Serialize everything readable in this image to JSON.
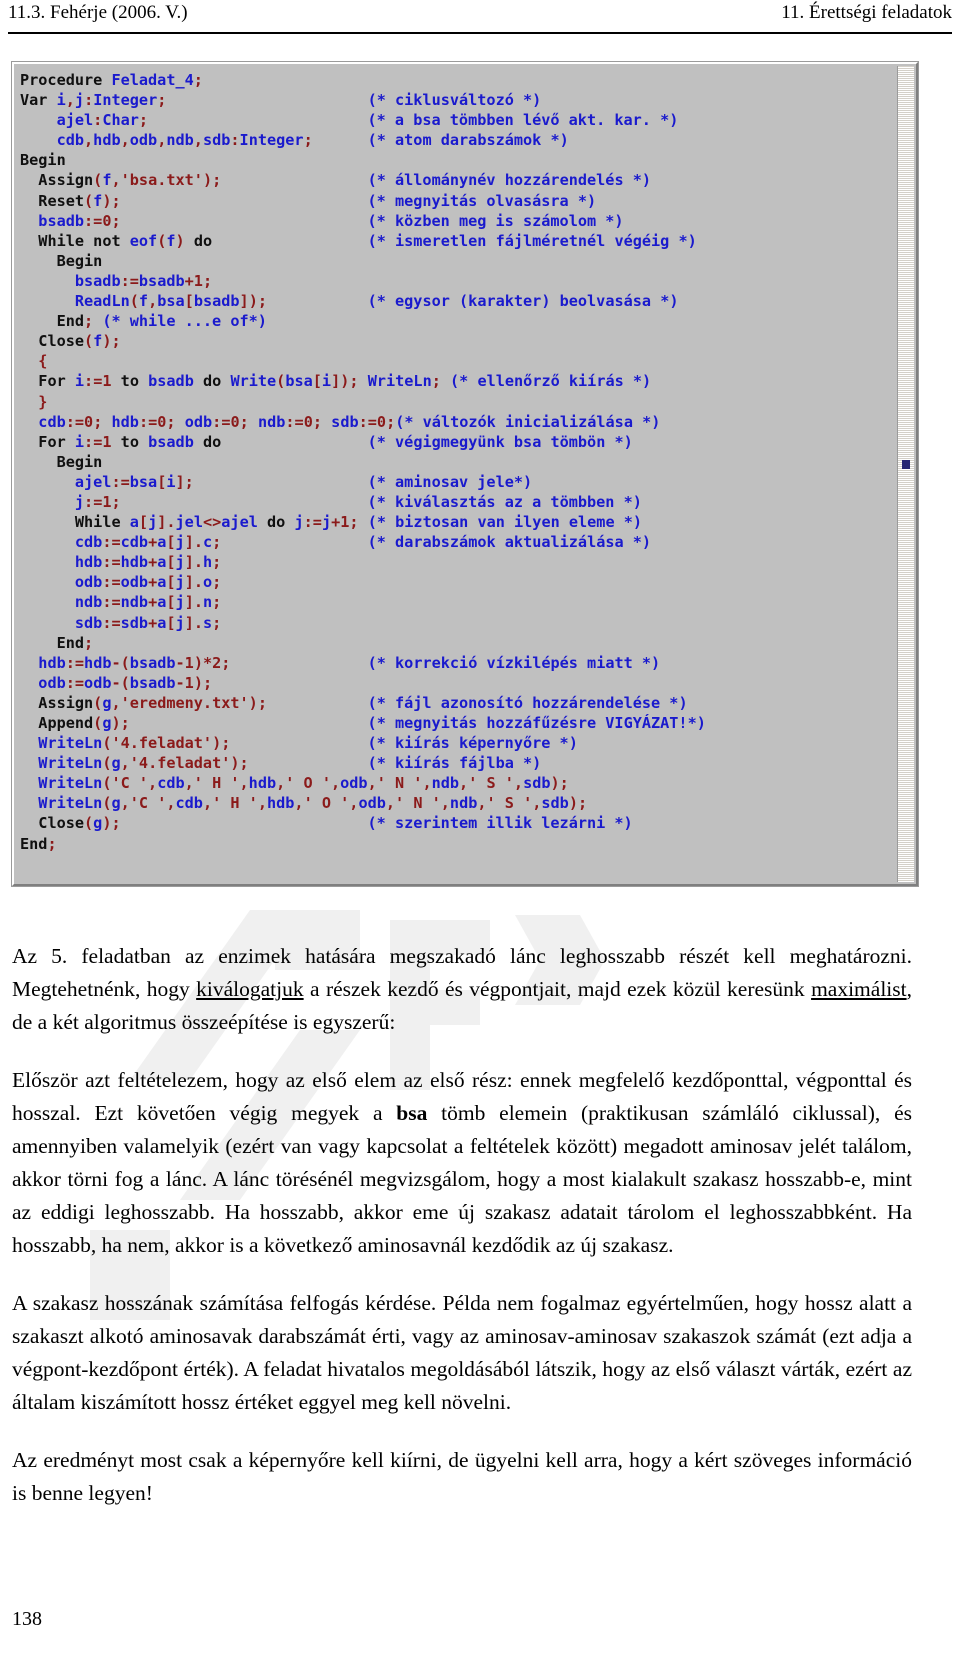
{
  "header": {
    "left": "11.3. Fehérje (2006. V.)",
    "right": "11. Érettségi feladatok"
  },
  "code_panel": {
    "language": "Pascal",
    "lines": [
      "Procedure Feladat_4;",
      "Var i,j:Integer;                      (* ciklusváltozó *)",
      "    ajel:Char;                        (* a bsa tömbben lévő akt. kar. *)",
      "    cdb,hdb,odb,ndb,sdb:Integer;      (* atom darabszámok *)",
      "Begin",
      "  Assign(f,'bsa.txt');                (* állománynév hozzárendelés *)",
      "  Reset(f);                           (* megnyitás olvasásra *)",
      "  bsadb:=0;                           (* közben meg is számolom *)",
      "  While not eof(f) do                 (* ismeretlen fájlméretnél végéig *)",
      "    Begin",
      "      bsadb:=bsadb+1;",
      "      ReadLn(f,bsa[bsadb]);           (* egysor (karakter) beolvasása *)",
      "    End; (* while ...e of*)",
      "  Close(f);",
      "  {",
      "  For i:=1 to bsadb do Write(bsa[i]); WriteLn; (* ellenőrző kiírás *)",
      "  }",
      "  cdb:=0; hdb:=0; odb:=0; ndb:=0; sdb:=0;(* változók inicializálása *)",
      "  For i:=1 to bsadb do                (* végigmegyünk bsa tömbön *)",
      "    Begin",
      "      ajel:=bsa[i];                   (* aminosav jele*)",
      "      j:=1;                           (* kiválasztás az a tömbben *)",
      "      While a[j].jel<>ajel do j:=j+1; (* biztosan van ilyen eleme *)",
      "      cdb:=cdb+a[j].c;                (* darabszámok aktualizálása *)",
      "      hdb:=hdb+a[j].h;",
      "      odb:=odb+a[j].o;",
      "      ndb:=ndb+a[j].n;",
      "      sdb:=sdb+a[j].s;",
      "    End;",
      "  hdb:=hdb-(bsadb-1)*2;               (* korrekció vízkilépés miatt *)",
      "  odb:=odb-(bsadb-1);",
      "  Assign(g,'eredmeny.txt');           (* fájl azonosító hozzárendelése *)",
      "  Append(g);                          (* megnyitás hozzáfűzésre VIGYÁZAT!*)",
      "  WriteLn('4.feladat');               (* kiírás képernyőre *)",
      "  WriteLn(g,'4.feladat');             (* kiírás fájlba *)",
      "  WriteLn('C ',cdb,' H ',hdb,' O ',odb,' N ',ndb,' S ',sdb);",
      "  WriteLn(g,'C ',cdb,' H ',hdb,' O ',odb,' N ',ndb,' S ',sdb);",
      "  Close(g);                           (* szerintem illik lezárni *)",
      "End;"
    ]
  },
  "body": {
    "paragraphs": [
      {
        "id": "p1",
        "runs": [
          {
            "text": "Az 5. feladatban az enzimek hatására megszakadó lánc leghosszabb részét kell meghatározni. Megtehetnénk, hogy ",
            "style": "normal"
          },
          {
            "text": "kiválogatjuk",
            "style": "underline"
          },
          {
            "text": " a részek kezdő és végpontjait, majd ezek közül keresünk ",
            "style": "normal"
          },
          {
            "text": "maximálist",
            "style": "underline"
          },
          {
            "text": ", de a két algoritmus összeépítése is egyszerű:",
            "style": "normal"
          }
        ]
      },
      {
        "id": "p2",
        "runs": [
          {
            "text": "Először azt feltételezem, hogy az első elem az első rész: ennek megfelelő kezdőponttal, végponttal és hosszal. Ezt követően végig megyek a ",
            "style": "normal"
          },
          {
            "text": "bsa",
            "style": "bold"
          },
          {
            "text": " tömb elemein (praktikusan számláló ciklussal), és amennyiben valamelyik (ezért van vagy kapcsolat a feltételek között) megadott aminosav jelét találom, akkor törni fog a lánc. A lánc törésénél megvizsgálom, hogy a most kialakult szakasz hosszabb-e, mint az eddigi leghosszabb. Ha hosszabb, akkor eme új szakasz adatait tárolom el leghosszabbként. Ha hosszabb, ha nem, akkor is a következő aminosavnál kezdődik az új szakasz.",
            "style": "normal"
          }
        ]
      },
      {
        "id": "p3",
        "runs": [
          {
            "text": "A szakasz hosszának számítása felfogás kérdése. Példa nem fogalmaz egyértelműen, hogy hossz alatt a szakaszt alkotó aminosavak darabszámát érti, vagy az aminosav-aminosav szakaszok számát (ezt adja a végpont-kezdőpont érték). A feladat hivatalos megoldásából látszik, hogy az első választ várták, ezért az általam kiszámított hossz értéket eggyel meg kell növelni.",
            "style": "normal"
          }
        ]
      },
      {
        "id": "p4",
        "runs": [
          {
            "text": "Az eredményt most csak a képernyőre kell kiírni, de ügyelni kell arra, hogy a kért szöveges információ is benne legyen!",
            "style": "normal"
          }
        ]
      }
    ]
  },
  "footer": {
    "page_number": "138"
  },
  "colors": {
    "code_background": "#c0c0c0",
    "code_identifier": "#1a1acd",
    "code_keyword": "#101010",
    "code_literal": "#8b1a1a",
    "page_background": "#ffffff",
    "text": "#000000"
  }
}
